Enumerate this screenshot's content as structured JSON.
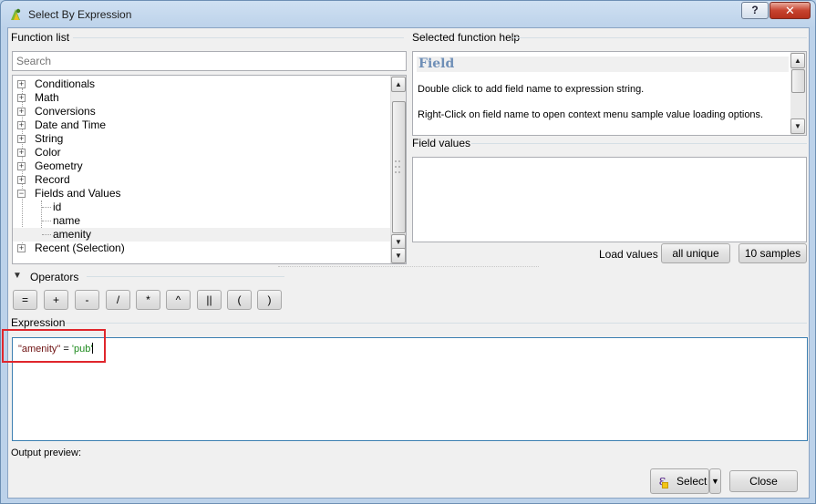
{
  "window": {
    "title": "Select By Expression",
    "help_button": "?",
    "close_button": "✕"
  },
  "function_list": {
    "group_title": "Function list",
    "search_placeholder": "Search",
    "items": [
      {
        "label": "Conditionals",
        "expander": "+"
      },
      {
        "label": "Math",
        "expander": "+"
      },
      {
        "label": "Conversions",
        "expander": "+"
      },
      {
        "label": "Date and Time",
        "expander": "+"
      },
      {
        "label": "String",
        "expander": "+"
      },
      {
        "label": "Color",
        "expander": "+"
      },
      {
        "label": "Geometry",
        "expander": "+"
      },
      {
        "label": "Record",
        "expander": "+"
      },
      {
        "label": "Fields and Values",
        "expander": "−"
      },
      {
        "label": "Recent (Selection)",
        "expander": "+"
      }
    ],
    "fields": [
      "id",
      "name",
      "amenity"
    ],
    "selected_field": "amenity"
  },
  "help": {
    "group_title": "Selected function help",
    "heading": "Field",
    "line1": "Double click to add field name to expression string.",
    "line2": "Right-Click on field name to open context menu sample value loading options."
  },
  "field_values": {
    "group_title": "Field values",
    "load_label": "Load values",
    "all_unique": "all unique",
    "samples": "10 samples"
  },
  "operators": {
    "title": "Operators",
    "buttons": [
      "=",
      "+",
      "-",
      "/",
      "*",
      "^",
      "||",
      "(",
      ")"
    ]
  },
  "expression": {
    "group_title": "Expression",
    "field_token": "\"amenity\"",
    "op_token": " = ",
    "string_token": "'pub'"
  },
  "footer": {
    "output_preview": "Output preview:",
    "select_label": "Select",
    "select_icon": "ε",
    "close_label": "Close"
  },
  "colors": {
    "field_token": "#6e1111",
    "string_token": "#1d8a1d",
    "help_heading": "#6f8fb7",
    "highlight_box": "#e0262c"
  }
}
